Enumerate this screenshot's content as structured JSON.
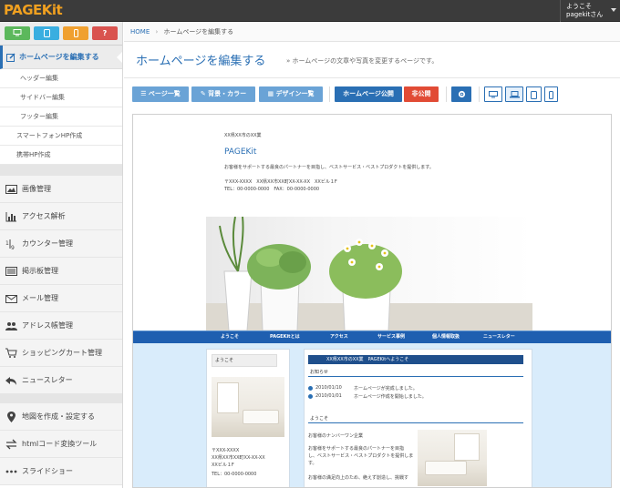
{
  "app": {
    "logo": "PAGEKit"
  },
  "header": {
    "welcome_line1": "ようこそ",
    "welcome_line2": "pagekitさん"
  },
  "device_buttons": [
    {
      "name": "desktop",
      "color": "#5cb85c"
    },
    {
      "name": "tablet",
      "color": "#3aaee0"
    },
    {
      "name": "smartphone",
      "color": "#f0a030"
    },
    {
      "name": "help",
      "color": "#d9534f"
    }
  ],
  "sidebar": {
    "active": "ホームページを編集する",
    "sub_items": [
      "ヘッダー編集",
      "サイドバー編集",
      "フッター編集"
    ],
    "sub_items2": [
      "スマートフォンHP作成",
      "携帯HP作成"
    ],
    "items": [
      {
        "label": "画像管理",
        "icon": "image-icon"
      },
      {
        "label": "アクセス解析",
        "icon": "bar-chart-icon"
      },
      {
        "label": "カウンター管理",
        "icon": "counter-icon"
      },
      {
        "label": "掲示板管理",
        "icon": "board-icon"
      },
      {
        "label": "メール管理",
        "icon": "mail-icon"
      },
      {
        "label": "アドレス帳管理",
        "icon": "users-icon"
      },
      {
        "label": "ショッピングカート管理",
        "icon": "cart-icon"
      },
      {
        "label": "ニュースレター",
        "icon": "reply-icon"
      }
    ],
    "items2": [
      {
        "label": "地図を作成・設定する",
        "icon": "map-marker-icon"
      },
      {
        "label": "htmlコード変換ツール",
        "icon": "exchange-icon"
      },
      {
        "label": "スライドショー",
        "icon": "ellipsis-icon"
      }
    ]
  },
  "breadcrumb": {
    "home": "HOME",
    "sep": "›",
    "current": "ホームページを編集する"
  },
  "page": {
    "title": "ホームページを編集する",
    "subtitle": "» ホームページの文章や写真を変更するページです。"
  },
  "toolbar": {
    "page_list": "ページ一覧",
    "bg_color": "背景・カラー",
    "design_list": "デザイン一覧",
    "publish": "ホームページ公開",
    "unpublish": "非公開"
  },
  "preview": {
    "pref": "XX県XX市のXX業",
    "site_title": "PAGEKit",
    "tagline": "お客様をサポートする最良のパートナーを目指し、ベストサービス・ベストプロダクトを提供します。",
    "address": "〒XXX-XXXX　XX県XX市XX町XX-XX-XX　XXビル１F",
    "phone": "TEL：00-0000-0000　FAX：00-0000-0000",
    "nav": [
      "ようこそ",
      "PAGEKitとは",
      "アクセス",
      "サービス事例",
      "個人情報取扱",
      "ニュースレター"
    ],
    "side_label": "ようこそ",
    "side_addr1": "〒XXX-XXXX",
    "side_addr2": "XX県XX市XX町XX-XX-XX",
    "side_addr3": "XXビル１F",
    "side_tel": "TEL：00-0000-0000",
    "welcome_heading": "XX県XX市のXX業　PAGEKitへようこそ",
    "news_heading": "お知らせ",
    "news": [
      {
        "date": "2010/01/10",
        "text": "ホームページが完成しました。"
      },
      {
        "date": "2010/01/01",
        "text": "ホームページ作成を開始しました。"
      }
    ],
    "welcome2_heading": "ようこそ",
    "body1": "お客様のナンバーワン企業",
    "body2": "お客様をサポートする最良のパートナーを目指",
    "body3": "し、ベストサービス・ベストプロダクトを提供しま",
    "body4": "す。",
    "body5": "お客様の満足向上のため、絶えず創造し、挑戦す"
  }
}
